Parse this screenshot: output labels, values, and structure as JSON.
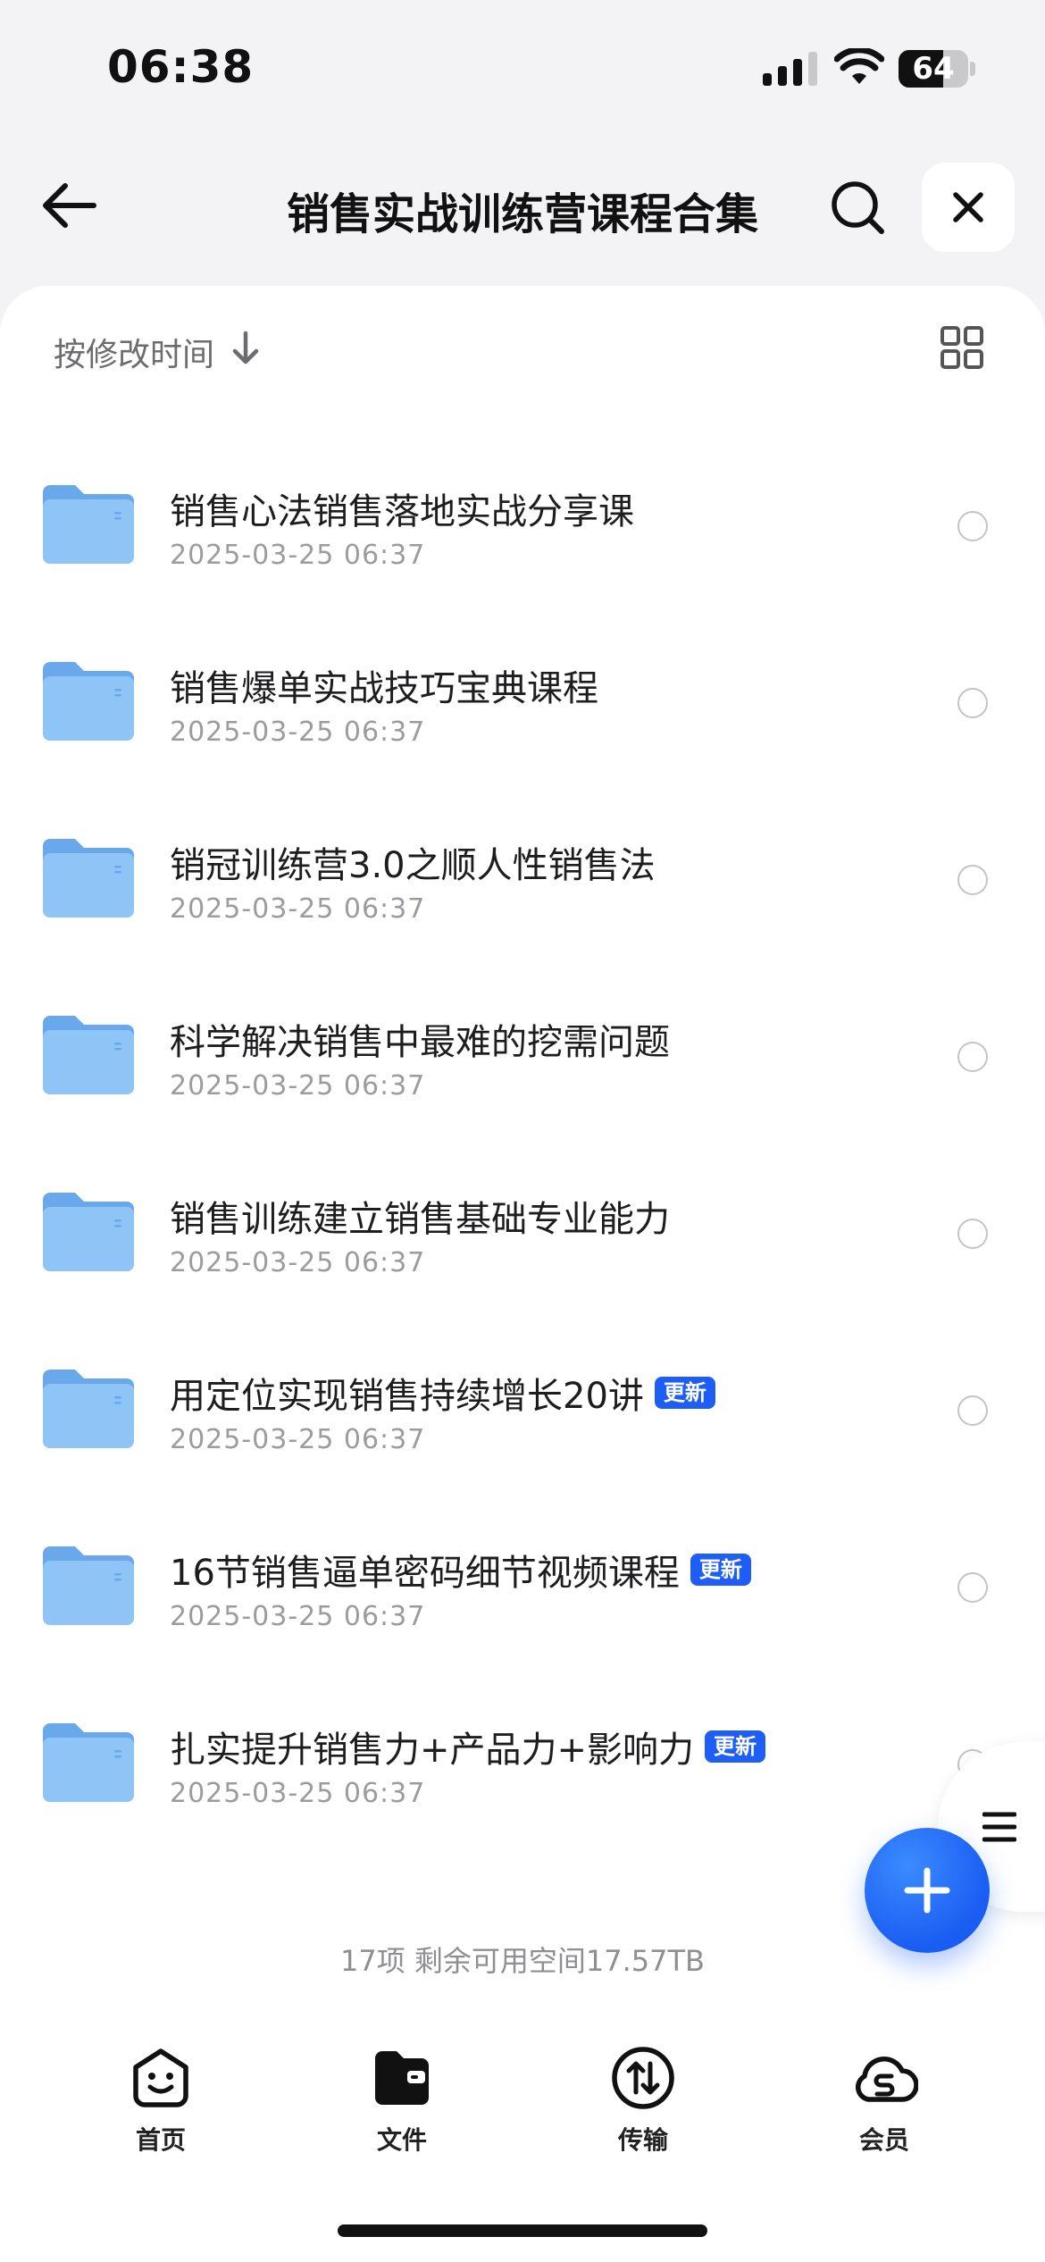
{
  "status_bar": {
    "time": "06:38",
    "battery": "64",
    "battery_level": 0.64
  },
  "header": {
    "title": "销售实战训练营课程合集"
  },
  "toolbar": {
    "sort_label": "按修改时间"
  },
  "files": [
    {
      "name": "",
      "date": "2025-03-25 06:37",
      "badge": ""
    },
    {
      "name": "销售心法销售落地实战分享课",
      "date": "2025-03-25 06:37",
      "badge": ""
    },
    {
      "name": "销售爆单实战技巧宝典课程",
      "date": "2025-03-25 06:37",
      "badge": ""
    },
    {
      "name": "销冠训练营3.0之顺人性销售法",
      "date": "2025-03-25 06:37",
      "badge": ""
    },
    {
      "name": "科学解决销售中最难的挖需问题",
      "date": "2025-03-25 06:37",
      "badge": ""
    },
    {
      "name": "销售训练建立销售基础专业能力",
      "date": "2025-03-25 06:37",
      "badge": ""
    },
    {
      "name": "用定位实现销售持续增长20讲",
      "date": "2025-03-25 06:37",
      "badge": "更新"
    },
    {
      "name": "16节销售逼单密码细节视频课程",
      "date": "2025-03-25 06:37",
      "badge": "更新"
    },
    {
      "name": "扎实提升销售力+产品力+影响力",
      "date": "2025-03-25 06:37",
      "badge": "更新"
    }
  ],
  "summary": "17项 剩余可用空间17.57TB",
  "tabs": [
    {
      "label": "首页",
      "icon": "smile-face-icon"
    },
    {
      "label": "文件",
      "icon": "folder-wallet-icon"
    },
    {
      "label": "传输",
      "icon": "transfer-icon"
    },
    {
      "label": "会员",
      "icon": "cloud-s-icon"
    }
  ],
  "colors": {
    "accent": "#1f5ef6",
    "folder": "#7ab4ef"
  }
}
